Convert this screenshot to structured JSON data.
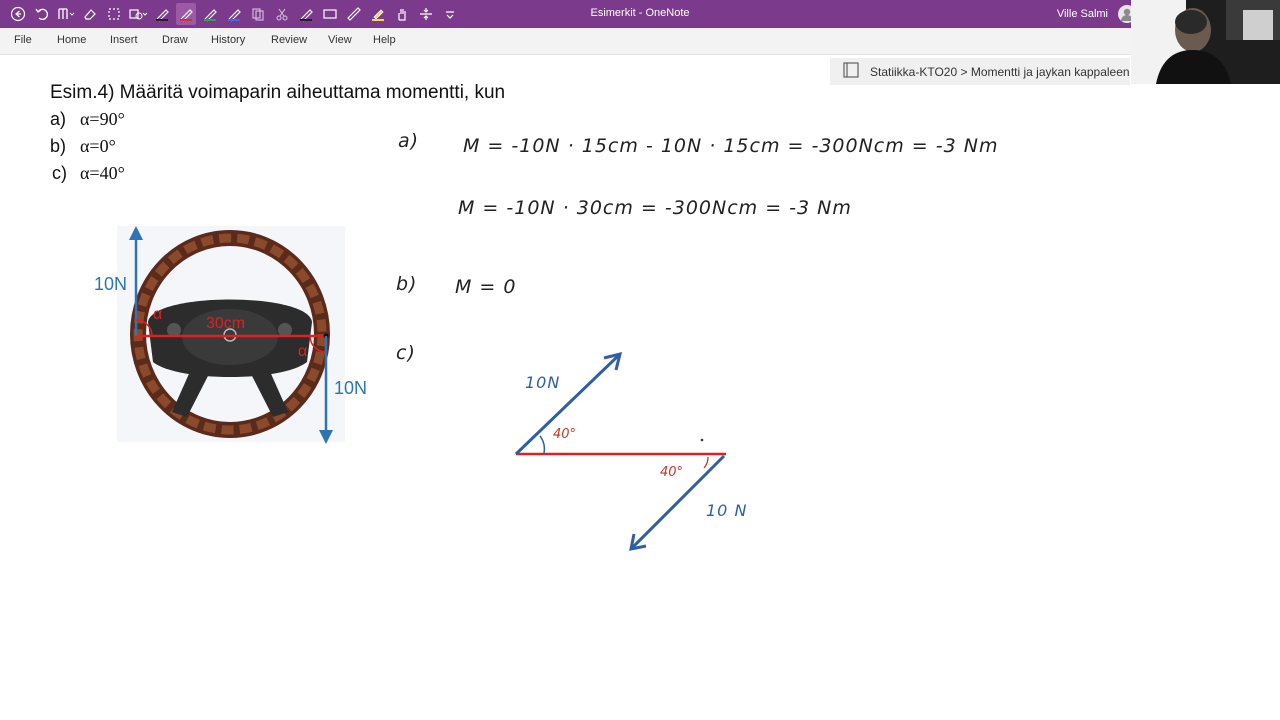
{
  "window": {
    "title": "Esimerkit - OneNote",
    "user": "Ville Salmi"
  },
  "toolbar": {
    "icons": [
      "back-icon",
      "undo-icon",
      "columns-icon",
      "eraser-icon",
      "lasso-icon",
      "shape-icon",
      "pen-icon",
      "pen-icon",
      "pen-icon",
      "pen-icon",
      "copy-icon",
      "cut-icon",
      "pen-icon",
      "rectangle-icon",
      "ruler-icon",
      "highlighter-icon",
      "hand-icon",
      "insert-space-icon",
      "more-icon"
    ]
  },
  "menu": {
    "items": [
      "File",
      "Home",
      "Insert",
      "Draw",
      "History",
      "Review",
      "View",
      "Help"
    ]
  },
  "breadcrumb": {
    "text": "Statiikka-KTO20 > Momentti ja jaykan kappaleen"
  },
  "question": {
    "title": "Esim.4) Määritä voimaparin aiheuttama momentti, kun",
    "parts": [
      {
        "label": "a)",
        "value": "α=90°"
      },
      {
        "label": "b)",
        "value": "α=0°"
      },
      {
        "label": "c)",
        "value": "α=40°"
      }
    ]
  },
  "figure": {
    "force_top": "10N",
    "force_bottom": "10N",
    "distance": "30cm",
    "angle_left": "α",
    "angle_right": "α"
  },
  "handwriting": {
    "a_label": "a)",
    "a_line1": "M = -10N · 15cm - 10N · 15cm = -300Ncm = -3 Nm",
    "a_line2": "M = -10N · 30cm = -300Ncm = -3 Nm",
    "b_label": "b)",
    "b_line": "M = 0",
    "c_label": "c)",
    "c_force_top": "10N",
    "c_force_bottom": "10 N",
    "c_angle_top": "40°",
    "c_angle_bottom": "40°"
  },
  "colors": {
    "titlebar": "#7b3a8c",
    "force_arrow": "#2e74b5",
    "handwriting_blue": "#2e5ea8",
    "handwriting_red": "#c0392b"
  }
}
